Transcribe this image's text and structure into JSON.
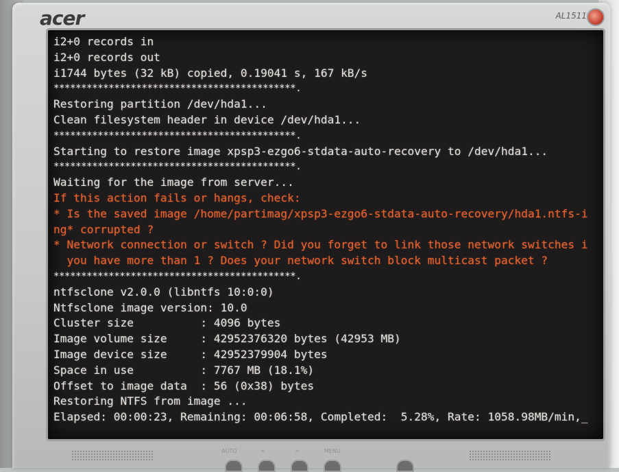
{
  "monitor": {
    "brand": "acer",
    "model": "AL1511"
  },
  "terminal": {
    "lines": [
      {
        "text": "i2+0 records in",
        "style": "normal"
      },
      {
        "text": "i2+0 records out",
        "style": "normal"
      },
      {
        "text": "i1744 bytes (32 kB) copied, 0.19041 s, 167 kB/s",
        "style": "normal"
      },
      {
        "text": "********************************************.",
        "style": "stars"
      },
      {
        "text": "Restoring partition /dev/hda1...",
        "style": "normal"
      },
      {
        "text": "Clean filesystem header in device /dev/hda1...",
        "style": "normal"
      },
      {
        "text": "********************************************.",
        "style": "stars"
      },
      {
        "text": "Starting to restore image xpsp3-ezgo6-stdata-auto-recovery to /dev/hda1...",
        "style": "normal"
      },
      {
        "text": "********************************************.",
        "style": "stars"
      },
      {
        "text": "Waiting for the image from server...",
        "style": "normal"
      },
      {
        "text": "If this action fails or hangs, check:",
        "style": "warn"
      },
      {
        "text": "* Is the saved image /home/partimag/xpsp3-ezgo6-stdata-auto-recovery/hda1.ntfs-i",
        "style": "warn"
      },
      {
        "text": "ng* corrupted ?",
        "style": "warn"
      },
      {
        "text": "* Network connection or switch ? Did you forget to link those network switches i",
        "style": "warn"
      },
      {
        "text": "  you have more than 1 ? Does your network switch block multicast packet ?",
        "style": "warn"
      },
      {
        "text": "********************************************.",
        "style": "stars"
      },
      {
        "text": "ntfsclone v2.0.0 (libntfs 10:0:0)",
        "style": "normal"
      },
      {
        "text": "Ntfsclone image version: 10.0",
        "style": "normal"
      },
      {
        "text": "Cluster size          : 4096 bytes",
        "style": "normal"
      },
      {
        "text": "Image volume size     : 42952376320 bytes (42953 MB)",
        "style": "normal"
      },
      {
        "text": "Image device size     : 42952379904 bytes",
        "style": "normal"
      },
      {
        "text": "Space in use          : 7767 MB (18.1%)",
        "style": "normal"
      },
      {
        "text": "Offset to image data  : 56 (0x38) bytes",
        "style": "normal"
      },
      {
        "text": "Restoring NTFS from image ...",
        "style": "normal"
      },
      {
        "text": "Elapsed: 00:00:23, Remaining: 00:06:58, Completed:  5.28%, Rate: 1058.98MB/min,_",
        "style": "normal"
      }
    ]
  },
  "front_panel": {
    "labels": [
      "AUTO",
      "<",
      ">",
      "MENU"
    ]
  }
}
